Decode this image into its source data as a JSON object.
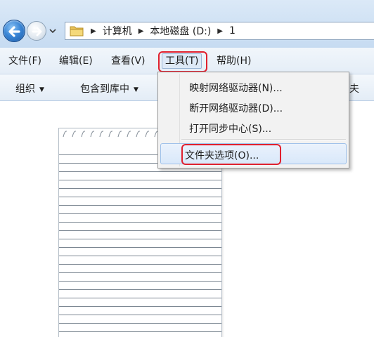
{
  "address_bar": {
    "breadcrumbs": [
      "计算机",
      "本地磁盘 (D:)",
      "1"
    ]
  },
  "menubar": {
    "items": [
      {
        "label": "文件(F)"
      },
      {
        "label": "编辑(E)"
      },
      {
        "label": "查看(V)"
      },
      {
        "label": "工具(T)",
        "active": true
      },
      {
        "label": "帮助(H)"
      }
    ]
  },
  "commandbar": {
    "items": [
      {
        "label": "组织"
      },
      {
        "label": "包含到库中"
      }
    ],
    "cut_off_text": "夫"
  },
  "tools_menu": {
    "items": [
      {
        "label": "映射网络驱动器(N)..."
      },
      {
        "label": "断开网络驱动器(D)..."
      },
      {
        "label": "打开同步中心(S)..."
      }
    ],
    "highlighted_item": {
      "label": "文件夹选项(O)..."
    }
  },
  "colors": {
    "highlight_ring": "#e0202e",
    "menu_hover": "#dde9f7"
  }
}
